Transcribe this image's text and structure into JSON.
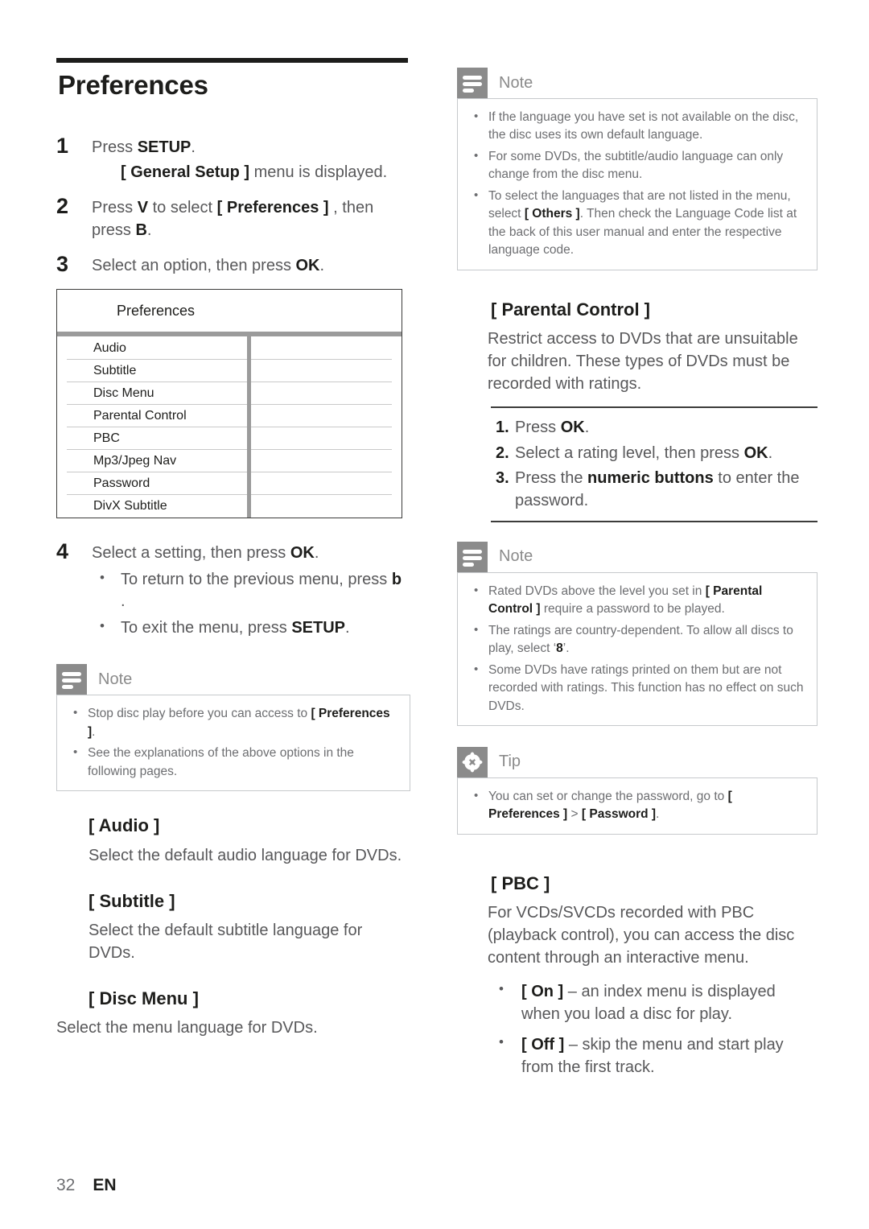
{
  "page": {
    "title": "Preferences",
    "footer_page_number": "32",
    "footer_language": "EN"
  },
  "colors": {
    "callout_icon_bg": "#8b8b8b",
    "callout_border": "#c6c9cc",
    "rule_dark": "#1d1d1b",
    "menu_divider": "#9b9b9b",
    "menu_row_line": "#c9c9c9"
  },
  "steps": [
    {
      "num": "1",
      "text": "Press SETUP.",
      "sub": "[ General Setup ] menu is displayed."
    },
    {
      "num": "2",
      "text": "Press V to select [ Preferences ] , then press B."
    },
    {
      "num": "3",
      "text": "Select an option, then press OK."
    },
    {
      "num": "4",
      "text": "Select a setting, then press OK.",
      "bullets": [
        "To return to the previous menu, press b .",
        "To exit the menu, press SETUP."
      ]
    }
  ],
  "preferences_menu": {
    "header": "Preferences",
    "rows": [
      "Audio",
      "Subtitle",
      "Disc Menu",
      "Parental Control",
      "PBC",
      "Mp3/Jpeg Nav",
      "Password",
      "DivX Subtitle"
    ]
  },
  "note_left": {
    "icon": "note-icon",
    "label": "Note",
    "items": [
      "Stop disc play before you can access to [ Preferences ].",
      "See the explanations of the above options in the following pages."
    ]
  },
  "options_left": [
    {
      "title": "[ Audio ]",
      "text": "Select the default audio language for DVDs."
    },
    {
      "title": "[ Subtitle ]",
      "text": "Select the default subtitle language for DVDs."
    },
    {
      "title": "[ Disc Menu ]",
      "text": "Select the menu language for DVDs."
    }
  ],
  "note_right_top": {
    "icon": "note-icon",
    "label": "Note",
    "items": [
      "If the language you have set is not available on the disc, the disc uses its own default language.",
      "For some DVDs, the subtitle/audio language can only change from the disc menu.",
      "To select the languages that are not listed in the menu, select [ Others ]. Then check the Language Code list at the back of this user manual and enter the respective language code."
    ]
  },
  "parental_control": {
    "title": "[ Parental Control ]",
    "text": "Restrict access to DVDs that are unsuitable for children. These types of DVDs must be recorded with ratings.",
    "procedure": [
      {
        "num": "1.",
        "text": "Press OK."
      },
      {
        "num": "2.",
        "text": "Select a rating level, then press OK."
      },
      {
        "num": "3.",
        "text": "Press the numeric buttons to enter the password."
      }
    ]
  },
  "note_right_bottom": {
    "icon": "note-icon",
    "label": "Note",
    "items": [
      "Rated DVDs above the level you set in [ Parental Control ] require a password to be played.",
      "The ratings are country-dependent. To allow all discs to play, select ‘8’.",
      "Some DVDs have ratings printed on them but are not recorded with ratings. This function has no effect on such DVDs."
    ]
  },
  "tip_right": {
    "icon": "tip-icon",
    "label": "Tip",
    "items": [
      "You can set or change the password, go to [ Preferences ] > [ Password ]."
    ]
  },
  "pbc": {
    "title": "[ PBC ]",
    "text": "For VCDs/SVCDs recorded with PBC (playback control), you can access the disc content through an interactive menu.",
    "bullets": [
      "[ On ] – an index menu is displayed when you load a disc for play.",
      "[ Off ] – skip the menu and start play from the first track."
    ]
  }
}
